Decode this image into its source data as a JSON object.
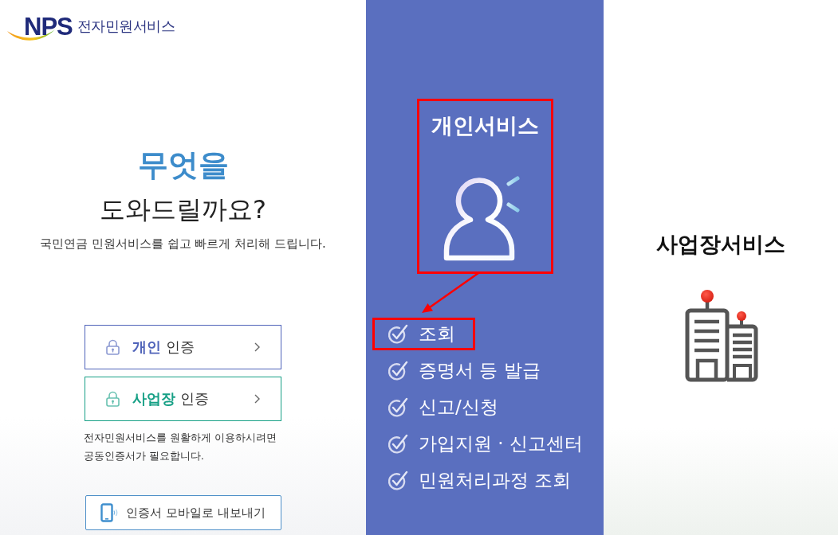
{
  "logo": {
    "mark": "NPS",
    "title": "전자민원서비스"
  },
  "intro": {
    "heading": "무엇을",
    "subheading": "도와드릴까요?",
    "description": "국민연금 민원서비스를 쉽고 빠르게 처리해 드립니다."
  },
  "login_buttons": [
    {
      "label": "**개인** 인증",
      "color": "#4f63b9"
    },
    {
      "label": "**사업장** 인증",
      "color": "#17a086"
    }
  ],
  "notice": "전자민원서비스를 원활하게 이용하시려면\n공동인증서가 필요합니다.",
  "mobile_export_button": {
    "label": "인증서 모바일로 내보내기"
  },
  "personal_service": {
    "title": "개인서비스",
    "highlighted": true,
    "arrow": true,
    "items": [
      {
        "label": "조회",
        "highlighted": true
      },
      {
        "label": "증명서 등 발급",
        "highlighted": false
      },
      {
        "label": "신고/신청",
        "highlighted": false
      },
      {
        "label": "가입지원 · 신고센터",
        "highlighted": false
      },
      {
        "label": "민원처리과정 조회",
        "highlighted": false
      }
    ]
  },
  "business_service": {
    "title": "사업장서비스"
  }
}
